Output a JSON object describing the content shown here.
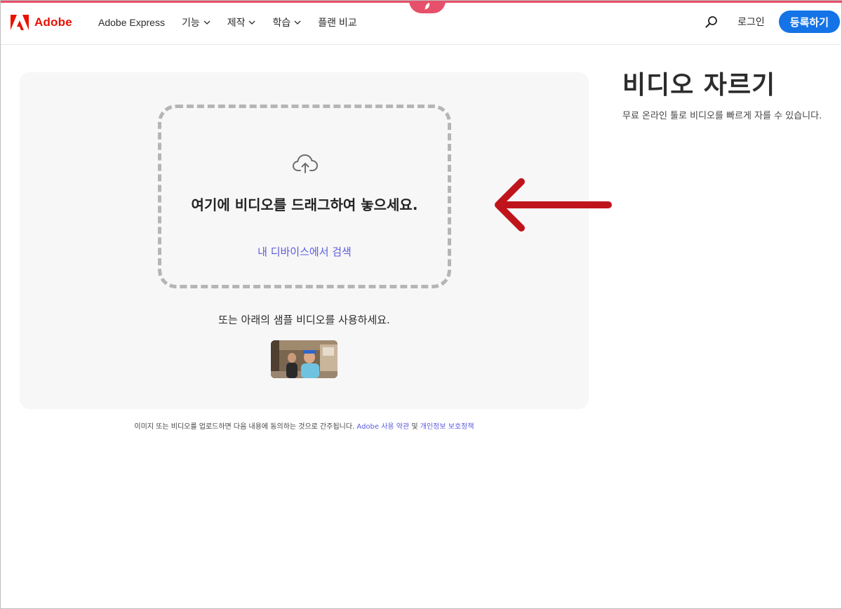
{
  "header": {
    "logo_text": "Adobe",
    "nav": [
      {
        "label": "Adobe Express",
        "dropdown": false
      },
      {
        "label": "기능",
        "dropdown": true
      },
      {
        "label": "제작",
        "dropdown": true
      },
      {
        "label": "학습",
        "dropdown": true
      },
      {
        "label": "플랜 비교",
        "dropdown": false
      }
    ],
    "login_label": "로그인",
    "signup_label": "등록하기"
  },
  "upload": {
    "drop_title": "여기에 비디오를 드래그하여 놓으세요.",
    "browse_label": "내 디바이스에서 검색",
    "sample_text": "또는 아래의 샘플 비디오를 사용하세요."
  },
  "terms": {
    "prefix": "이미지 또는 비디오를 업로드하면 다음 내용에 동의하는 것으로 간주됩니다. ",
    "terms_link": "Adobe 사용 약관",
    "conjunction": " 및 ",
    "privacy_link": "개인정보 보호정책"
  },
  "page": {
    "title": "비디오 자르기",
    "description": "무료 온라인 툴로 비디오를 빠르게 자를 수 있습니다."
  },
  "colors": {
    "brand_red": "#eb1000",
    "primary_blue": "#1473e6",
    "link_purple": "#5c5ce0",
    "accent_pink": "#e7506a",
    "annotation_red": "#c0141c"
  },
  "icons": [
    "adobe-logo-icon",
    "chevron-down-icon",
    "search-icon",
    "cloud-upload-icon",
    "annotation-arrow"
  ]
}
